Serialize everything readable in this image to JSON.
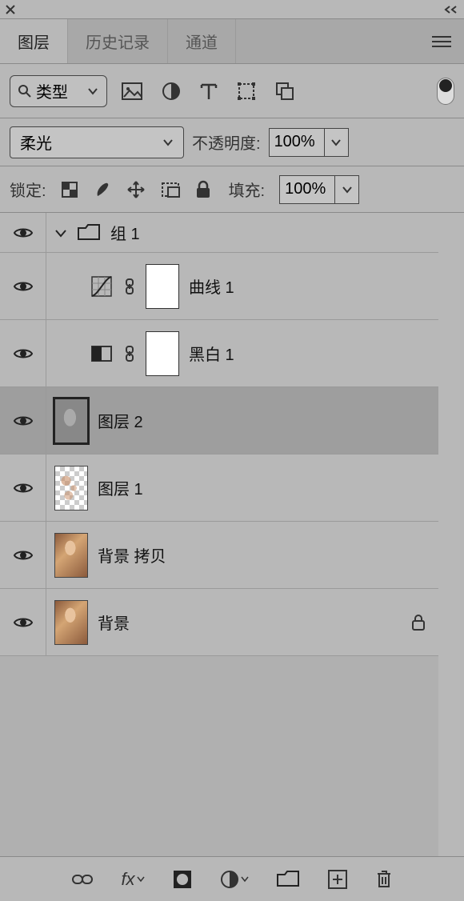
{
  "tabs": {
    "layers": "图层",
    "history": "历史记录",
    "channels": "通道"
  },
  "filter": {
    "label": "类型"
  },
  "blend": {
    "mode": "柔光",
    "opacity_label": "不透明度:",
    "opacity_value": "100%"
  },
  "lock": {
    "label": "锁定:",
    "fill_label": "填充:",
    "fill_value": "100%"
  },
  "layers": {
    "group": "组 1",
    "curves": "曲线 1",
    "bw": "黑白 1",
    "layer2": "图层 2",
    "layer1": "图层 1",
    "bgcopy": "背景 拷贝",
    "bg": "背景"
  }
}
